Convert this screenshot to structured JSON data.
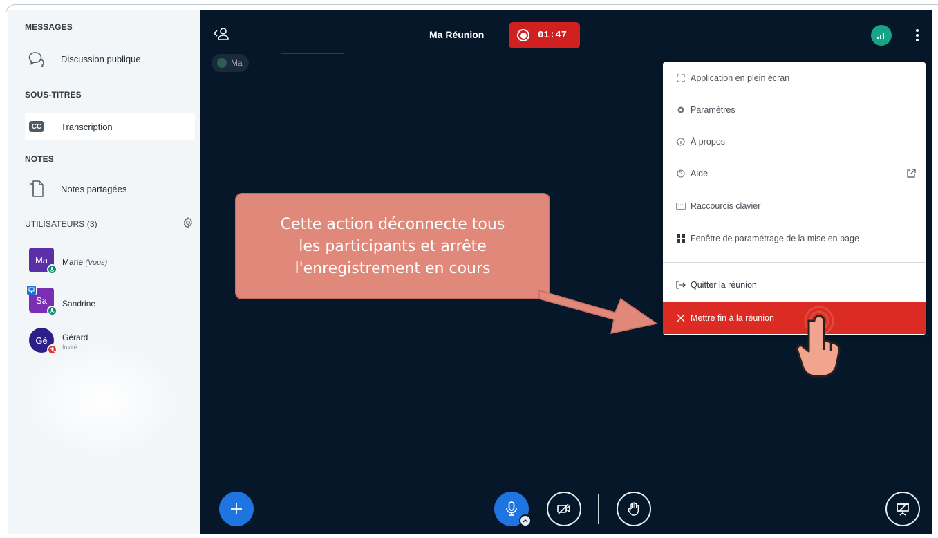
{
  "sidebar": {
    "messages_title": "MESSAGES",
    "public_chat_label": "Discussion publique",
    "captions_title": "SOUS-TITRES",
    "transcription_label": "Transcription",
    "transcription_badge": "CC",
    "notes_title": "NOTES",
    "shared_notes_label": "Notes partagées",
    "users_title": "UTILISATEURS (3)",
    "users": [
      {
        "initials": "Ma",
        "name": "Marie",
        "suffix": "(Vous)",
        "role": "",
        "color": "#5b2fa8"
      },
      {
        "initials": "Sa",
        "name": "Sandrine",
        "suffix": "",
        "role": "",
        "color": "#7a2fb3"
      },
      {
        "initials": "Gé",
        "name": "Gérard",
        "suffix": "",
        "role": "Invité",
        "color": "#2d1f8a"
      }
    ]
  },
  "meeting": {
    "title": "Ma Réunion",
    "recording_time": "01:47",
    "talking_chip": "Ma"
  },
  "menu": {
    "items": [
      {
        "icon": "fullscreen-icon",
        "label": "Application en plein écran"
      },
      {
        "icon": "settings-icon",
        "label": "Paramètres"
      },
      {
        "icon": "info-icon",
        "label": "À propos"
      },
      {
        "icon": "help-icon",
        "label": "Aide"
      },
      {
        "icon": "keyboard-icon",
        "label": "Raccourcis clavier"
      },
      {
        "icon": "layout-icon",
        "label": "Fenêtre de paramétrage de la mise en page"
      }
    ],
    "leave_label": "Quitter la réunion",
    "end_label": "Mettre fin à la réunion"
  },
  "callout": {
    "line1": "Cette action déconnecte tous",
    "line2": "les participants et arrête",
    "line3": "l'enregistrement en cours"
  },
  "colors": {
    "main_bg": "#06172a",
    "record": "#d0201f",
    "danger": "#dc2b22",
    "accent_blue": "#1e74e0",
    "callout": "#e0887a",
    "connection": "#17a589"
  }
}
